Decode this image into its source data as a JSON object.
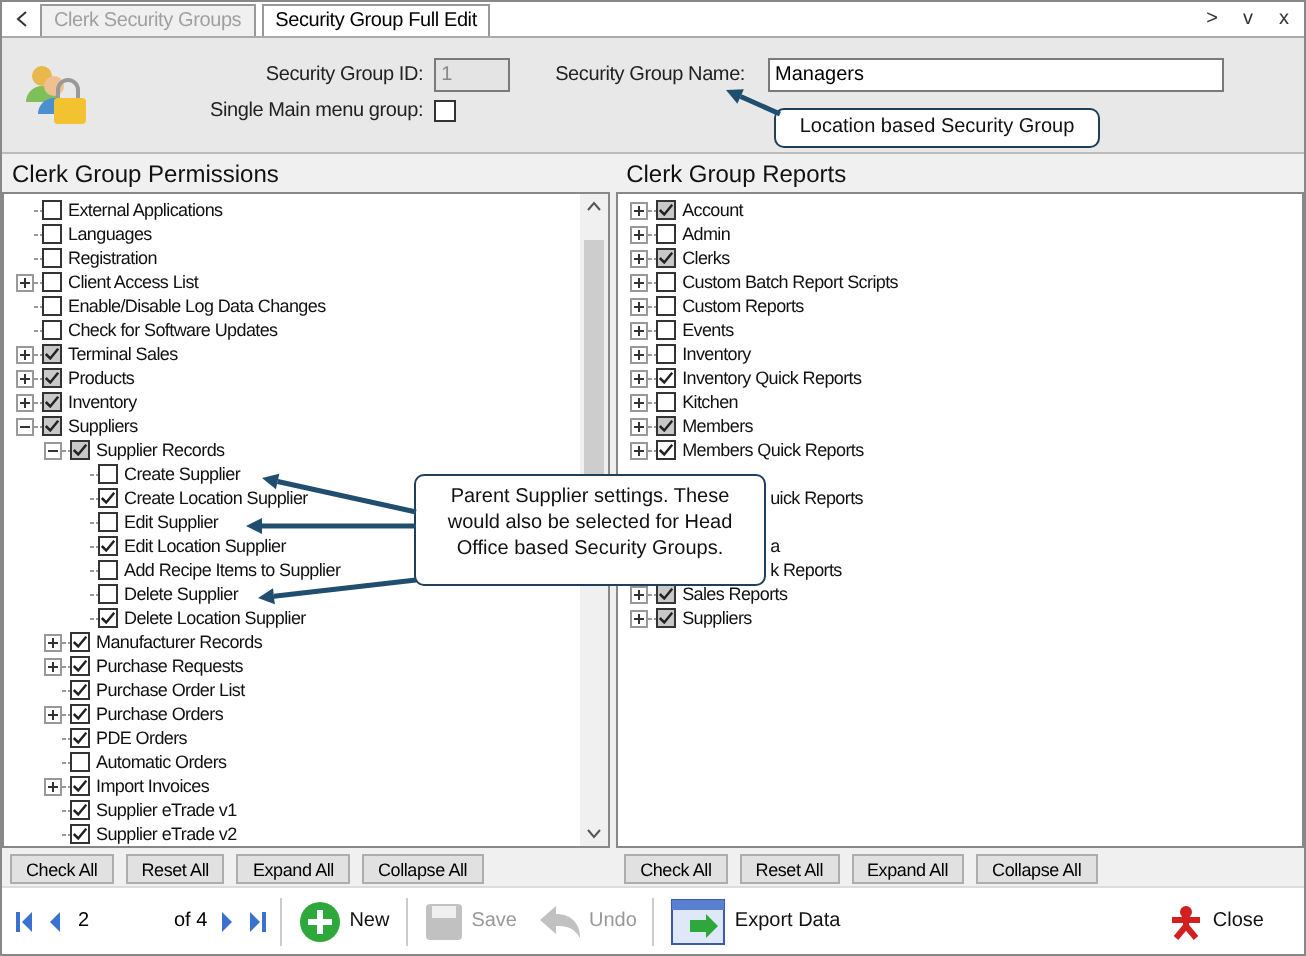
{
  "tabs": [
    {
      "label": "Clerk Security Groups",
      "selected": false
    },
    {
      "label": "Security Group Full Edit",
      "selected": true
    }
  ],
  "tab_scroll": {
    "next": ">",
    "menu": "v",
    "close": "x"
  },
  "header": {
    "id_label": "Security Group ID:",
    "id_value": "1",
    "name_label": "Security Group Name:",
    "name_value": "Managers",
    "single_label": "Single Main menu group:",
    "single_checked": false
  },
  "permissions": {
    "title": "Clerk Group Permissions",
    "items": [
      {
        "label": "External Applications",
        "checked": false,
        "mixed": false,
        "expandable": false
      },
      {
        "label": "Languages",
        "checked": false,
        "mixed": false,
        "expandable": false
      },
      {
        "label": "Registration",
        "checked": false,
        "mixed": false,
        "expandable": false
      },
      {
        "label": "Client Access List",
        "checked": false,
        "mixed": false,
        "expandable": true,
        "expanded": false
      },
      {
        "label": "Enable/Disable Log Data Changes",
        "checked": false,
        "mixed": false,
        "expandable": false
      },
      {
        "label": "Check for Software Updates",
        "checked": false,
        "mixed": false,
        "expandable": false
      },
      {
        "label": "Terminal Sales",
        "checked": true,
        "mixed": true,
        "expandable": true,
        "expanded": false
      },
      {
        "label": "Products",
        "checked": true,
        "mixed": true,
        "expandable": true,
        "expanded": false
      },
      {
        "label": "Inventory",
        "checked": true,
        "mixed": true,
        "expandable": true,
        "expanded": false
      },
      {
        "label": "Suppliers",
        "checked": true,
        "mixed": true,
        "expandable": true,
        "expanded": true,
        "children": [
          {
            "label": "Supplier Records",
            "checked": true,
            "mixed": true,
            "expandable": true,
            "expanded": true,
            "children": [
              {
                "label": "Create Supplier",
                "checked": false,
                "mixed": false,
                "expandable": false
              },
              {
                "label": "Create Location Supplier",
                "checked": true,
                "mixed": false,
                "expandable": false
              },
              {
                "label": "Edit Supplier",
                "checked": false,
                "mixed": false,
                "expandable": false
              },
              {
                "label": "Edit Location Supplier",
                "checked": true,
                "mixed": false,
                "expandable": false
              },
              {
                "label": "Add Recipe Items to Supplier",
                "checked": false,
                "mixed": false,
                "expandable": false
              },
              {
                "label": "Delete Supplier",
                "checked": false,
                "mixed": false,
                "expandable": false
              },
              {
                "label": "Delete Location Supplier",
                "checked": true,
                "mixed": false,
                "expandable": false
              }
            ]
          },
          {
            "label": "Manufacturer Records",
            "checked": true,
            "mixed": false,
            "expandable": true,
            "expanded": false
          },
          {
            "label": "Purchase Requests",
            "checked": true,
            "mixed": false,
            "expandable": true,
            "expanded": false
          },
          {
            "label": "Purchase Order List",
            "checked": true,
            "mixed": false,
            "expandable": false
          },
          {
            "label": "Purchase Orders",
            "checked": true,
            "mixed": false,
            "expandable": true,
            "expanded": false
          },
          {
            "label": "PDE Orders",
            "checked": true,
            "mixed": false,
            "expandable": false
          },
          {
            "label": "Automatic Orders",
            "checked": false,
            "mixed": false,
            "expandable": false
          },
          {
            "label": "Import Invoices",
            "checked": true,
            "mixed": false,
            "expandable": true,
            "expanded": false
          },
          {
            "label": "Supplier eTrade v1",
            "checked": true,
            "mixed": false,
            "expandable": false
          },
          {
            "label": "Supplier eTrade v2",
            "checked": true,
            "mixed": false,
            "expandable": false
          }
        ]
      }
    ],
    "buttons": [
      "Check All",
      "Reset All",
      "Expand All",
      "Collapse All"
    ]
  },
  "reports": {
    "title": "Clerk Group Reports",
    "items": [
      {
        "label": "Account",
        "checked": true,
        "mixed": true,
        "expandable": true,
        "expanded": false
      },
      {
        "label": "Admin",
        "checked": false,
        "mixed": false,
        "expandable": true,
        "expanded": false
      },
      {
        "label": "Clerks",
        "checked": true,
        "mixed": true,
        "expandable": true,
        "expanded": false
      },
      {
        "label": "Custom Batch Report Scripts",
        "checked": false,
        "mixed": false,
        "expandable": true,
        "expanded": false
      },
      {
        "label": "Custom Reports",
        "checked": false,
        "mixed": false,
        "expandable": true,
        "expanded": false
      },
      {
        "label": "Events",
        "checked": false,
        "mixed": false,
        "expandable": true,
        "expanded": false
      },
      {
        "label": "Inventory",
        "checked": false,
        "mixed": false,
        "expandable": true,
        "expanded": false
      },
      {
        "label": "Inventory Quick Reports",
        "checked": true,
        "mixed": false,
        "expandable": true,
        "expanded": false
      },
      {
        "label": "Kitchen",
        "checked": false,
        "mixed": false,
        "expandable": true,
        "expanded": false
      },
      {
        "label": "Members",
        "checked": true,
        "mixed": true,
        "expandable": true,
        "expanded": false
      },
      {
        "label": "Members Quick Reports",
        "checked": true,
        "mixed": false,
        "expandable": true,
        "expanded": false
      },
      {
        "kind": "covered"
      },
      {
        "kind": "covered",
        "label": "uick Reports"
      },
      {
        "kind": "covered"
      },
      {
        "kind": "covered",
        "label": "a"
      },
      {
        "kind": "covered",
        "label": "k Reports"
      },
      {
        "label": "Sales Reports",
        "checked": true,
        "mixed": true,
        "expandable": true,
        "expanded": false
      },
      {
        "label": "Suppliers",
        "checked": true,
        "mixed": true,
        "expandable": true,
        "expanded": false
      }
    ],
    "buttons": [
      "Check All",
      "Reset All",
      "Expand All",
      "Collapse All"
    ]
  },
  "callouts": [
    {
      "text": "Location based Security Group"
    },
    {
      "text": "Parent Supplier settings. These would also be selected for Head Office based Security Groups."
    }
  ],
  "toolbar": {
    "page": "2",
    "of": "of 4",
    "new": "New",
    "save": "Save",
    "save_disabled": true,
    "undo": "Undo",
    "undo_disabled": true,
    "export": "Export Data",
    "close": "Close"
  }
}
